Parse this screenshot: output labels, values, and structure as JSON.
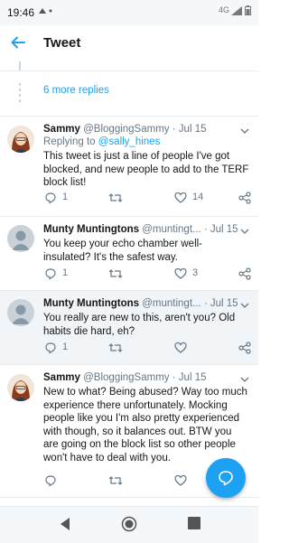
{
  "status_bar": {
    "time": "19:46",
    "network": "4G"
  },
  "app_bar": {
    "title": "Tweet"
  },
  "more_replies": "6 more replies",
  "tweets": [
    {
      "name": "Sammy",
      "handle": "@BloggingSammy",
      "dot": "·",
      "date": "Jul 15",
      "replying_prefix": "Replying to",
      "replying_handle": "@sally_hines",
      "text": "This tweet is just a line of people I've got blocked, and new people to add to the TERF block list!",
      "replies": "1",
      "likes": "14"
    },
    {
      "name": "Munty Muntingtons",
      "handle": "@muntingt...",
      "dot": "·",
      "date": "Jul 15",
      "text": "You keep your echo chamber well-insulated? It's the safest way.",
      "replies": "1",
      "likes": "3"
    },
    {
      "name": "Munty Muntingtons",
      "handle": "@muntingt...",
      "dot": "·",
      "date": "Jul 15",
      "text": "You really are new to this, aren't you? Old habits die hard, eh?",
      "replies": "1"
    },
    {
      "name": "Sammy",
      "handle": "@BloggingSammy",
      "dot": "·",
      "date": "Jul 15",
      "text": "New to what? Being abused? Way too much experience there unfortunately. Mocking people like you I'm also pretty experienced with though, so it balances out. BTW you are going on the block list so other people won't have to deal with you."
    }
  ],
  "colors": {
    "accent": "#1da1f2",
    "secondary_text": "#657786",
    "highlight_bg": "#f2f5f7"
  },
  "icons": [
    "back-arrow-icon",
    "reply-icon",
    "retweet-icon",
    "like-icon",
    "share-icon",
    "compose-reply-icon",
    "chevron-down-icon",
    "nav-back-icon",
    "nav-home-icon",
    "nav-recents-icon"
  ]
}
